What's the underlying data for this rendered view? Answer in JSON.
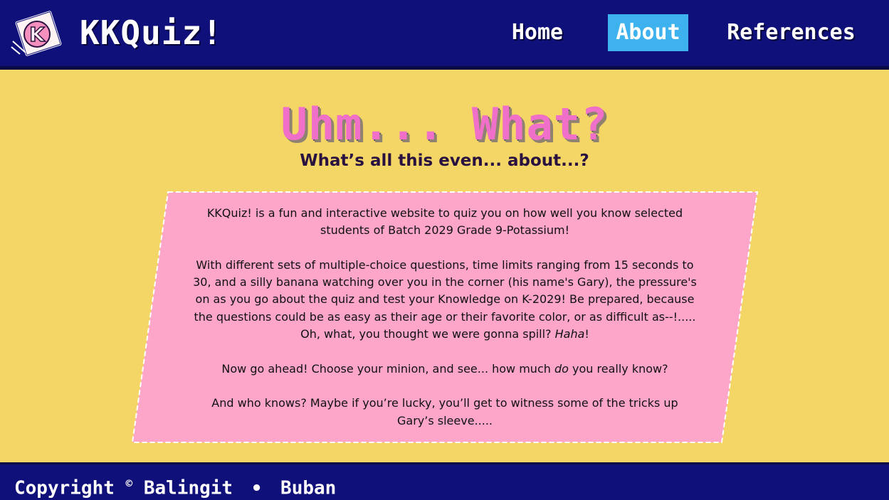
{
  "header": {
    "brand": "KKQuiz!",
    "logo_letter": "K",
    "nav": [
      {
        "label": "Home",
        "active": false
      },
      {
        "label": "About",
        "active": true
      },
      {
        "label": "References",
        "active": false
      }
    ],
    "active_color": "#3db2ee"
  },
  "main": {
    "title": "Uhm... What?",
    "subtitle": "What’s all this even... about...?",
    "card": {
      "p1": "KKQuiz! is a fun and interactive website to quiz you on how well you know selected students of Batch 2029 Grade 9-Potassium!",
      "p2_main": "With different sets of multiple-choice questions, time limits ranging from 15 seconds to 30, and a silly banana watching over you in the corner (his name's Gary), the pressure's on as you go about the quiz and test your Knowledge on K-2029! Be prepared, because the questions could be as easy as their age or their favorite color, or as difficult as--!..... Oh, what, you thought we were gonna spill? ",
      "p2_italic": "Haha",
      "p2_end": "!",
      "p3_start": "Now go ahead! Choose your minion, and see... how much ",
      "p3_italic": "do",
      "p3_end": " you really know?",
      "p4": "And who knows? Maybe if you’re lucky, you’ll get to witness some of the tricks up Gary’s sleeve....."
    }
  },
  "footer": {
    "copyright_label": "Copyright",
    "copyright_symbol": "©",
    "author1": "Balingit",
    "separator": "•",
    "author2": "Buban"
  },
  "colors": {
    "navy": "#10107a",
    "background_yellow": "#f3d665",
    "card_pink": "#fda6c9",
    "title_pink": "#f06fc9"
  }
}
